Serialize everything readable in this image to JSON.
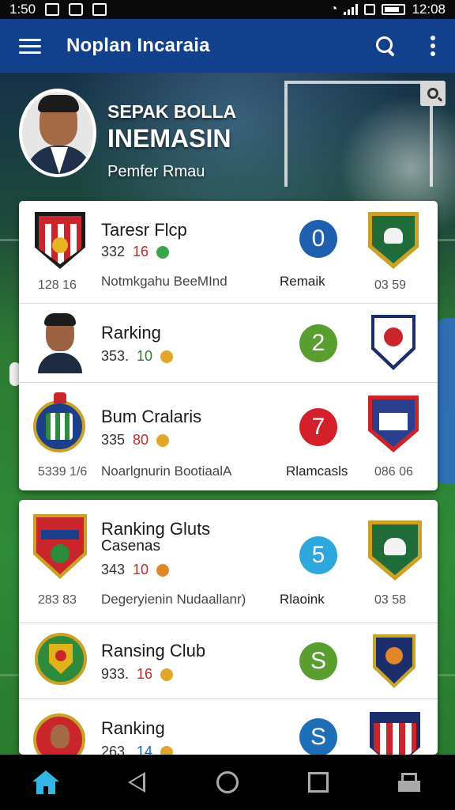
{
  "status_bar": {
    "time_left": "1:50",
    "time_right": "12:08"
  },
  "app_bar": {
    "title": "Noplan Incaraia",
    "menu_icon": "menu-icon",
    "search_icon": "search-icon",
    "more_icon": "more-vert-icon",
    "color": "#12408c"
  },
  "hero": {
    "title_line1": "SEPAK BOLLA",
    "title_line2": "INEMASIN",
    "subtitle": "Pemfer Rmau"
  },
  "cards": [
    {
      "rows": [
        {
          "name": "Taresr Flcp",
          "stats": [
            "332",
            "16"
          ],
          "left_num": "128 16",
          "description": "Notmkgahu BeeMInd",
          "right_label": "Remaik",
          "right_num": "03 59",
          "score": "0",
          "score_color": "#1e5fb0"
        },
        {
          "name": "Rarking",
          "stats": [
            "353.",
            "10"
          ],
          "score": "2",
          "score_color": "#5a9e2f"
        },
        {
          "name": "Bum Cralaris",
          "stats": [
            "335",
            "80"
          ],
          "left_num": "5339 1/6",
          "description": "Noarlgnurin BootiaalA",
          "right_label": "Rlamcasls",
          "right_num": "086 06",
          "score": "7",
          "score_color": "#d4202b"
        }
      ]
    },
    {
      "rows": [
        {
          "name": "Ranking Gluts",
          "subname": "Casenas",
          "stats": [
            "343",
            "10"
          ],
          "left_num": "283 83",
          "description": "Degeryienin Nudaallanr)",
          "right_label": "Rlaoink",
          "right_num": "03 58",
          "score": "5",
          "score_color": "#2ea8dc"
        },
        {
          "name": "Ransing Club",
          "stats": [
            "933.",
            "16"
          ],
          "score": "S",
          "score_color": "#5a9e2f"
        },
        {
          "name": "Ranking",
          "stats": [
            "263.",
            "14"
          ],
          "score": "S",
          "score_color": "#1e6fb8"
        }
      ]
    }
  ],
  "bottom_nav": {
    "home_icon": "home-icon",
    "back_icon": "back-icon",
    "circle_icon": "home-circle-icon",
    "square_icon": "recents-icon",
    "share_icon": "share-icon"
  }
}
